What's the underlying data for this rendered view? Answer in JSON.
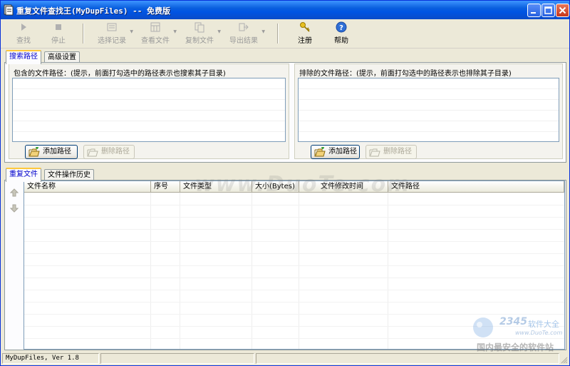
{
  "window": {
    "title": "重复文件查找王(MyDupFiles) -- 免费版",
    "controls": {
      "minimize": "minimize",
      "maximize": "maximize",
      "close": "close"
    }
  },
  "toolbar": {
    "find": "查找",
    "stop": "停止",
    "select_records": "选择记录",
    "view_files": "查看文件",
    "copy_files": "复制文件",
    "export_results": "导出结果",
    "register": "注册",
    "help": "帮助"
  },
  "top_tabs": [
    "搜索路径",
    "高级设置"
  ],
  "include_panel": {
    "label": "包含的文件路径：(提示，前面打勾选中的路径表示也搜索其子目录)",
    "add_button": "添加路径",
    "delete_button": "删除路径"
  },
  "exclude_panel": {
    "label": "排除的文件路径：(提示，前面打勾选中的路径表示也排除其子目录)",
    "add_button": "添加路径",
    "delete_button": "删除路径"
  },
  "bottom_tabs": [
    "重复文件",
    "文件操作历史"
  ],
  "results_table": {
    "columns": [
      "文件名称",
      "序号",
      "文件类型",
      "大小(Bytes)",
      "文件修改时间",
      "文件路径"
    ]
  },
  "statusbar": {
    "version": "MyDupFiles, Ver 1.8"
  },
  "watermarks": {
    "center": "www.DuoTe.com",
    "logo_number": "2345",
    "logo_text": "软件大全",
    "logo_url": "www.DuoTe.com",
    "slogan": "国内最安全的软件站"
  }
}
